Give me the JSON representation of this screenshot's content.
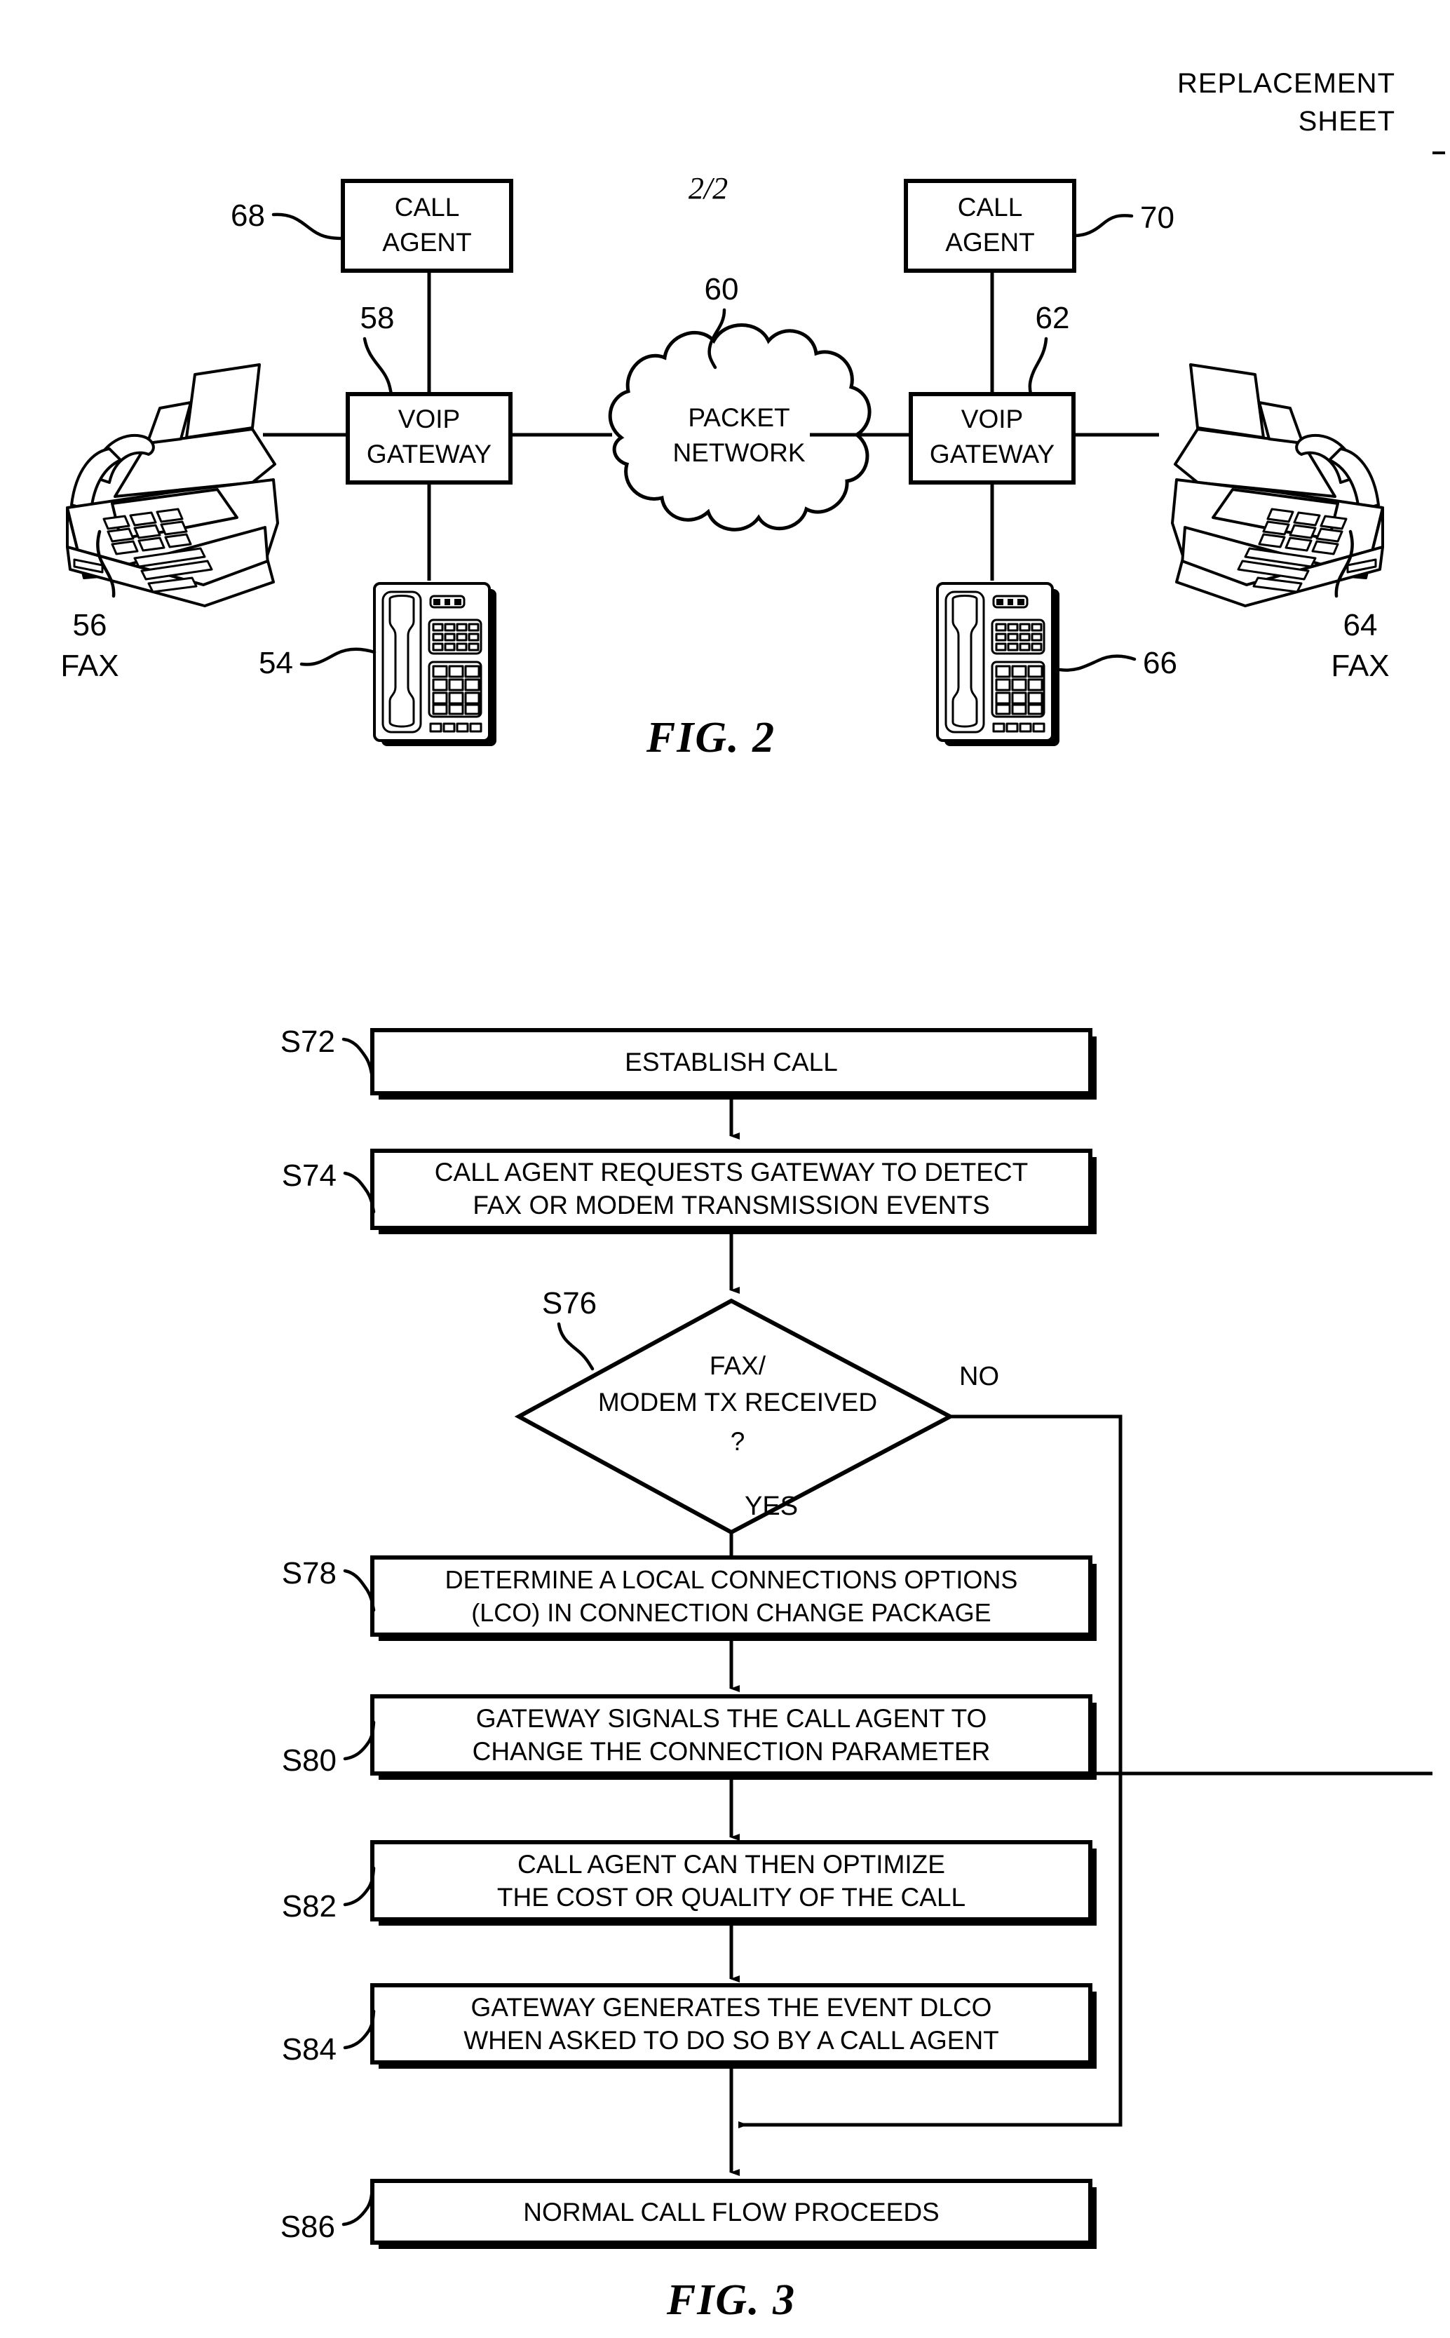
{
  "sheet": {
    "header_line1": "REPLACEMENT",
    "header_line2": "SHEET",
    "page_number": "2/2"
  },
  "figure2": {
    "caption": "FIG. 2",
    "nodes": {
      "call_agent_left": {
        "line1": "CALL",
        "line2": "AGENT",
        "ref": "68"
      },
      "call_agent_right": {
        "line1": "CALL",
        "line2": "AGENT",
        "ref": "70"
      },
      "voip_gateway_left": {
        "line1": "VOIP",
        "line2": "GATEWAY",
        "ref": "58"
      },
      "voip_gateway_right": {
        "line1": "VOIP",
        "line2": "GATEWAY",
        "ref": "62"
      },
      "packet_network": {
        "line1": "PACKET",
        "line2": "NETWORK",
        "ref": "60"
      },
      "fax_left": {
        "ref": "56",
        "label": "FAX"
      },
      "fax_right": {
        "ref": "64",
        "label": "FAX"
      },
      "phone_left": {
        "ref": "54"
      },
      "phone_right": {
        "ref": "66"
      }
    }
  },
  "figure3": {
    "caption": "FIG. 3",
    "steps": [
      {
        "id": "S72",
        "lines": [
          "ESTABLISH CALL"
        ],
        "shape": "process"
      },
      {
        "id": "S74",
        "lines": [
          "CALL AGENT REQUESTS GATEWAY TO DETECT",
          "FAX OR MODEM TRANSMISSION EVENTS"
        ],
        "shape": "process"
      },
      {
        "id": "S76",
        "lines": [
          "FAX/",
          "MODEM TX RECEIVED",
          "?"
        ],
        "shape": "decision"
      },
      {
        "id": "S78",
        "lines": [
          "DETERMINE A LOCAL CONNECTIONS OPTIONS",
          "(LCO) IN CONNECTION CHANGE PACKAGE"
        ],
        "shape": "process"
      },
      {
        "id": "S80",
        "lines": [
          "GATEWAY SIGNALS THE CALL AGENT TO",
          "CHANGE THE CONNECTION PARAMETER"
        ],
        "shape": "process"
      },
      {
        "id": "S82",
        "lines": [
          "CALL AGENT CAN THEN OPTIMIZE",
          "THE COST OR QUALITY OF THE CALL"
        ],
        "shape": "process"
      },
      {
        "id": "S84",
        "lines": [
          "GATEWAY GENERATES THE EVENT DLCO",
          "WHEN ASKED TO DO SO BY A CALL AGENT"
        ],
        "shape": "process"
      },
      {
        "id": "S86",
        "lines": [
          "NORMAL CALL FLOW PROCEEDS"
        ],
        "shape": "process"
      }
    ],
    "branches": {
      "yes": "YES",
      "no": "NO"
    }
  },
  "colors": {
    "ink": "#000000",
    "paper": "#ffffff"
  }
}
